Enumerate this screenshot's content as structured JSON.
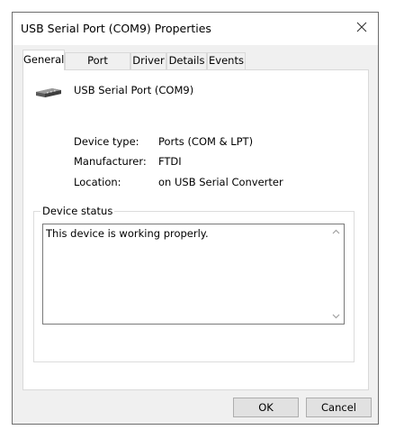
{
  "window": {
    "title": "USB Serial Port (COM9) Properties",
    "close_icon": "close-icon"
  },
  "tabs": [
    {
      "label": "General",
      "active": true
    },
    {
      "label": "Port Settings",
      "active": false
    },
    {
      "label": "Driver",
      "active": false
    },
    {
      "label": "Details",
      "active": false
    },
    {
      "label": "Events",
      "active": false
    }
  ],
  "device": {
    "icon": "serial-port-icon",
    "name": "USB Serial Port (COM9)"
  },
  "properties": [
    {
      "label": "Device type:",
      "value": "Ports (COM & LPT)"
    },
    {
      "label": "Manufacturer:",
      "value": "FTDI"
    },
    {
      "label": "Location:",
      "value": "on USB Serial Converter"
    }
  ],
  "device_status": {
    "title": "Device status",
    "text": "This device is working properly."
  },
  "buttons": {
    "ok": "OK",
    "cancel": "Cancel"
  }
}
